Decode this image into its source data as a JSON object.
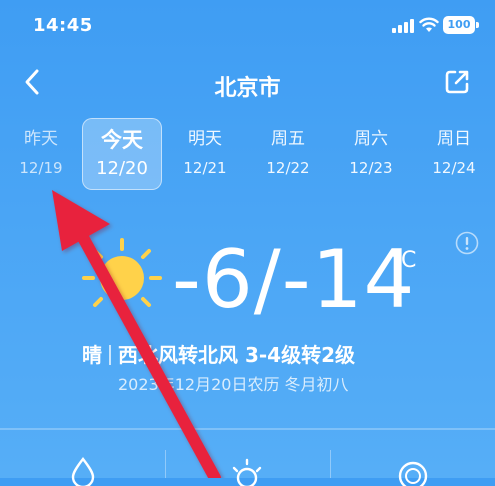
{
  "status_bar": {
    "time": "14:45",
    "battery": "100"
  },
  "nav": {
    "city": "北京市"
  },
  "days": [
    {
      "name": "昨天",
      "date": "12/19"
    },
    {
      "name": "今天",
      "date": "12/20"
    },
    {
      "name": "明天",
      "date": "12/21"
    },
    {
      "name": "周五",
      "date": "12/22"
    },
    {
      "name": "周六",
      "date": "12/23"
    },
    {
      "name": "周日",
      "date": "12/24"
    }
  ],
  "weather": {
    "temperature_range": "-6/-14",
    "unit": "°C",
    "condition": "晴",
    "wind": "西北风转北风 3-4级转2级",
    "date_line": "2023年12月20日农历 冬月初八"
  },
  "colors": {
    "background": "#4aa5f5",
    "sun": "#ffd24a",
    "annotation_arrow": "#e8243c"
  }
}
